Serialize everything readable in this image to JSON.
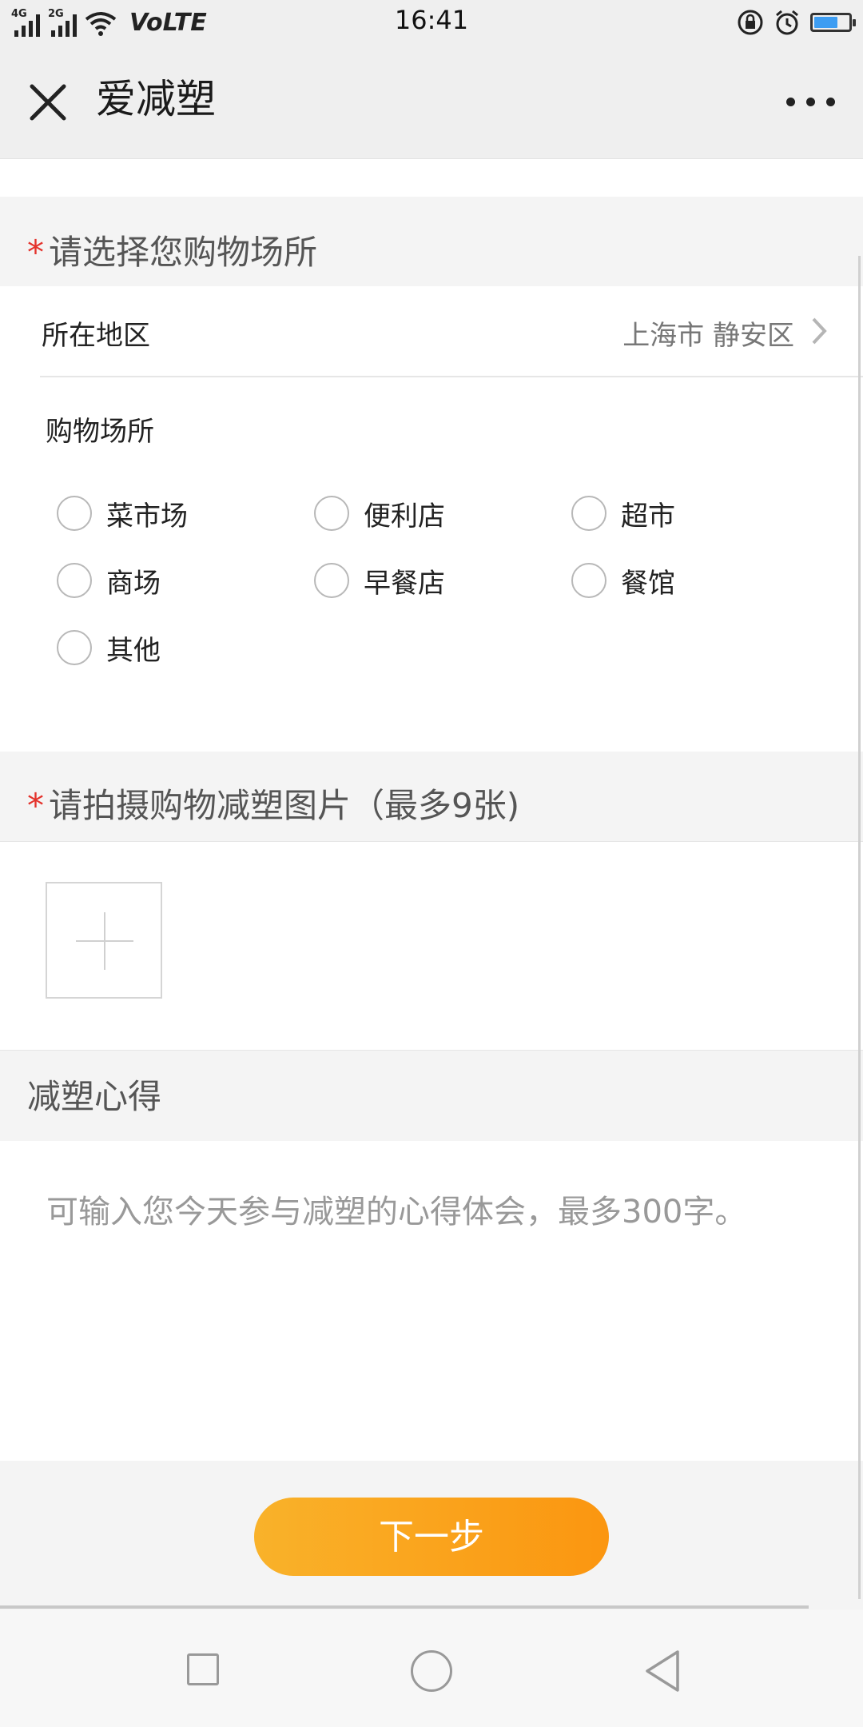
{
  "status_bar": {
    "time": "16:41",
    "signal1_tag": "4G",
    "signal2_tag": "2G",
    "volte": "VoLTE",
    "battery_level": 0.7,
    "icons": [
      "signal-icon",
      "wifi-icon",
      "lock-rotation-icon",
      "alarm-icon",
      "battery-icon"
    ]
  },
  "nav": {
    "title": "爱减塑",
    "close_icon": "close-icon",
    "more_icon": "more-icon"
  },
  "shopping_place_section": {
    "required_mark": "*",
    "title": "请选择您购物场所",
    "region_label": "所在地区",
    "region_value": "上海市 静安区",
    "place_label": "购物场所",
    "options": [
      "菜市场",
      "便利店",
      "超市",
      "商场",
      "早餐店",
      "餐馆",
      "其他"
    ]
  },
  "photo_section": {
    "required_mark": "*",
    "title": "请拍摄购物减塑图片（最多9张)"
  },
  "experience_section": {
    "title": "减塑心得",
    "placeholder": "可输入您今天参与减塑的心得体会，最多300字。"
  },
  "next_button": "下一步",
  "theme": {
    "accent_start": "#f9b22a",
    "accent_end": "#fb9610",
    "required_color": "#e4322b"
  }
}
